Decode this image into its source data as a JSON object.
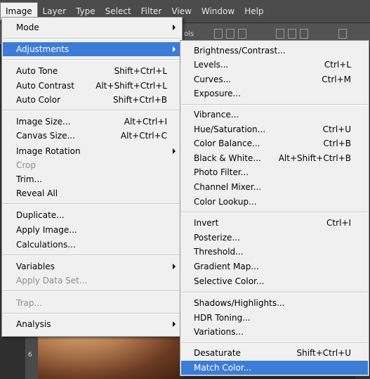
{
  "menubar": {
    "items": [
      "Image",
      "Layer",
      "Type",
      "Select",
      "Filter",
      "View",
      "Window",
      "Help"
    ]
  },
  "toolbar": {
    "text": "ols"
  },
  "ruler": {
    "label": "6"
  },
  "image_menu": {
    "items": [
      {
        "label": "Mode",
        "shortcut": "",
        "submenu": true,
        "disabled": false,
        "highlighted": false
      },
      {
        "label": "Adjustments",
        "shortcut": "",
        "submenu": true,
        "disabled": false,
        "highlighted": true
      },
      {
        "label": "Auto Tone",
        "shortcut": "Shift+Ctrl+L",
        "submenu": false,
        "disabled": false,
        "highlighted": false
      },
      {
        "label": "Auto Contrast",
        "shortcut": "Alt+Shift+Ctrl+L",
        "submenu": false,
        "disabled": false,
        "highlighted": false
      },
      {
        "label": "Auto Color",
        "shortcut": "Shift+Ctrl+B",
        "submenu": false,
        "disabled": false,
        "highlighted": false
      },
      {
        "label": "Image Size...",
        "shortcut": "Alt+Ctrl+I",
        "submenu": false,
        "disabled": false,
        "highlighted": false
      },
      {
        "label": "Canvas Size...",
        "shortcut": "Alt+Ctrl+C",
        "submenu": false,
        "disabled": false,
        "highlighted": false
      },
      {
        "label": "Image Rotation",
        "shortcut": "",
        "submenu": true,
        "disabled": false,
        "highlighted": false
      },
      {
        "label": "Crop",
        "shortcut": "",
        "submenu": false,
        "disabled": true,
        "highlighted": false
      },
      {
        "label": "Trim...",
        "shortcut": "",
        "submenu": false,
        "disabled": false,
        "highlighted": false
      },
      {
        "label": "Reveal All",
        "shortcut": "",
        "submenu": false,
        "disabled": false,
        "highlighted": false
      },
      {
        "label": "Duplicate...",
        "shortcut": "",
        "submenu": false,
        "disabled": false,
        "highlighted": false
      },
      {
        "label": "Apply Image...",
        "shortcut": "",
        "submenu": false,
        "disabled": false,
        "highlighted": false
      },
      {
        "label": "Calculations...",
        "shortcut": "",
        "submenu": false,
        "disabled": false,
        "highlighted": false
      },
      {
        "label": "Variables",
        "shortcut": "",
        "submenu": true,
        "disabled": false,
        "highlighted": false
      },
      {
        "label": "Apply Data Set...",
        "shortcut": "",
        "submenu": false,
        "disabled": true,
        "highlighted": false
      },
      {
        "label": "Trap...",
        "shortcut": "",
        "submenu": false,
        "disabled": true,
        "highlighted": false
      },
      {
        "label": "Analysis",
        "shortcut": "",
        "submenu": true,
        "disabled": false,
        "highlighted": false
      }
    ]
  },
  "adjustments_menu": {
    "items": [
      {
        "label": "Brightness/Contrast...",
        "shortcut": "",
        "highlighted": false
      },
      {
        "label": "Levels...",
        "shortcut": "Ctrl+L",
        "highlighted": false
      },
      {
        "label": "Curves...",
        "shortcut": "Ctrl+M",
        "highlighted": false
      },
      {
        "label": "Exposure...",
        "shortcut": "",
        "highlighted": false
      },
      {
        "label": "Vibrance...",
        "shortcut": "",
        "highlighted": false
      },
      {
        "label": "Hue/Saturation...",
        "shortcut": "Ctrl+U",
        "highlighted": false
      },
      {
        "label": "Color Balance...",
        "shortcut": "Ctrl+B",
        "highlighted": false
      },
      {
        "label": "Black & White...",
        "shortcut": "Alt+Shift+Ctrl+B",
        "highlighted": false
      },
      {
        "label": "Photo Filter...",
        "shortcut": "",
        "highlighted": false
      },
      {
        "label": "Channel Mixer...",
        "shortcut": "",
        "highlighted": false
      },
      {
        "label": "Color Lookup...",
        "shortcut": "",
        "highlighted": false
      },
      {
        "label": "Invert",
        "shortcut": "Ctrl+I",
        "highlighted": false
      },
      {
        "label": "Posterize...",
        "shortcut": "",
        "highlighted": false
      },
      {
        "label": "Threshold...",
        "shortcut": "",
        "highlighted": false
      },
      {
        "label": "Gradient Map...",
        "shortcut": "",
        "highlighted": false
      },
      {
        "label": "Selective Color...",
        "shortcut": "",
        "highlighted": false
      },
      {
        "label": "Shadows/Highlights...",
        "shortcut": "",
        "highlighted": false
      },
      {
        "label": "HDR Toning...",
        "shortcut": "",
        "highlighted": false
      },
      {
        "label": "Variations...",
        "shortcut": "",
        "highlighted": false
      },
      {
        "label": "Desaturate",
        "shortcut": "Shift+Ctrl+U",
        "highlighted": false
      },
      {
        "label": "Match Color...",
        "shortcut": "",
        "highlighted": true
      }
    ]
  },
  "colors": {
    "highlight": "#3d7cd6",
    "menu_bg": "#f0f0f0",
    "menubar_bg": "#4b4b4b",
    "disabled_text": "#8d8d8d"
  }
}
